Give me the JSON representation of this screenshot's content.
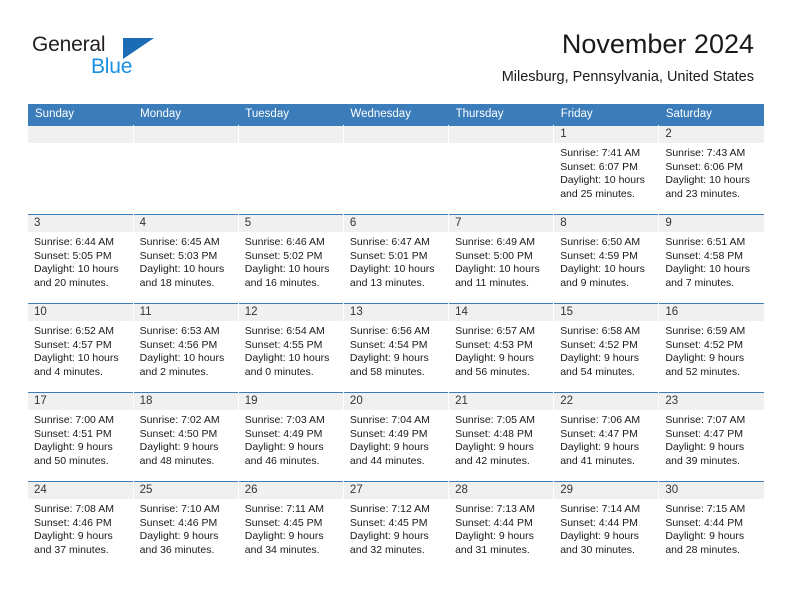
{
  "brand": {
    "name_top": "General",
    "name_bottom": "Blue",
    "triangle_icon": "triangle-icon",
    "color_dark": "#231f20",
    "color_blue": "#1b8ee0",
    "color_triangle": "#1b6bb5"
  },
  "header": {
    "title": "November 2024",
    "subtitle": "Milesburg, Pennsylvania, United States"
  },
  "theme": {
    "header_row_bg": "#3b7cba",
    "header_row_text": "#ffffff",
    "date_band_bg": "#f0f0f0",
    "cell_bg": "#ffffff",
    "row_divider": "#3b7cba"
  },
  "columns": [
    "Sunday",
    "Monday",
    "Tuesday",
    "Wednesday",
    "Thursday",
    "Friday",
    "Saturday"
  ],
  "weeks": [
    [
      {
        "date": "",
        "sunrise": "",
        "sunset": "",
        "daylight_line1": "",
        "daylight_line2": "",
        "empty": true
      },
      {
        "date": "",
        "sunrise": "",
        "sunset": "",
        "daylight_line1": "",
        "daylight_line2": "",
        "empty": true
      },
      {
        "date": "",
        "sunrise": "",
        "sunset": "",
        "daylight_line1": "",
        "daylight_line2": "",
        "empty": true
      },
      {
        "date": "",
        "sunrise": "",
        "sunset": "",
        "daylight_line1": "",
        "daylight_line2": "",
        "empty": true
      },
      {
        "date": "",
        "sunrise": "",
        "sunset": "",
        "daylight_line1": "",
        "daylight_line2": "",
        "empty": true
      },
      {
        "date": "1",
        "sunrise": "Sunrise: 7:41 AM",
        "sunset": "Sunset: 6:07 PM",
        "daylight_line1": "Daylight: 10 hours",
        "daylight_line2": "and 25 minutes.",
        "empty": false
      },
      {
        "date": "2",
        "sunrise": "Sunrise: 7:43 AM",
        "sunset": "Sunset: 6:06 PM",
        "daylight_line1": "Daylight: 10 hours",
        "daylight_line2": "and 23 minutes.",
        "empty": false
      }
    ],
    [
      {
        "date": "3",
        "sunrise": "Sunrise: 6:44 AM",
        "sunset": "Sunset: 5:05 PM",
        "daylight_line1": "Daylight: 10 hours",
        "daylight_line2": "and 20 minutes.",
        "empty": false
      },
      {
        "date": "4",
        "sunrise": "Sunrise: 6:45 AM",
        "sunset": "Sunset: 5:03 PM",
        "daylight_line1": "Daylight: 10 hours",
        "daylight_line2": "and 18 minutes.",
        "empty": false
      },
      {
        "date": "5",
        "sunrise": "Sunrise: 6:46 AM",
        "sunset": "Sunset: 5:02 PM",
        "daylight_line1": "Daylight: 10 hours",
        "daylight_line2": "and 16 minutes.",
        "empty": false
      },
      {
        "date": "6",
        "sunrise": "Sunrise: 6:47 AM",
        "sunset": "Sunset: 5:01 PM",
        "daylight_line1": "Daylight: 10 hours",
        "daylight_line2": "and 13 minutes.",
        "empty": false
      },
      {
        "date": "7",
        "sunrise": "Sunrise: 6:49 AM",
        "sunset": "Sunset: 5:00 PM",
        "daylight_line1": "Daylight: 10 hours",
        "daylight_line2": "and 11 minutes.",
        "empty": false
      },
      {
        "date": "8",
        "sunrise": "Sunrise: 6:50 AM",
        "sunset": "Sunset: 4:59 PM",
        "daylight_line1": "Daylight: 10 hours",
        "daylight_line2": "and 9 minutes.",
        "empty": false
      },
      {
        "date": "9",
        "sunrise": "Sunrise: 6:51 AM",
        "sunset": "Sunset: 4:58 PM",
        "daylight_line1": "Daylight: 10 hours",
        "daylight_line2": "and 7 minutes.",
        "empty": false
      }
    ],
    [
      {
        "date": "10",
        "sunrise": "Sunrise: 6:52 AM",
        "sunset": "Sunset: 4:57 PM",
        "daylight_line1": "Daylight: 10 hours",
        "daylight_line2": "and 4 minutes.",
        "empty": false
      },
      {
        "date": "11",
        "sunrise": "Sunrise: 6:53 AM",
        "sunset": "Sunset: 4:56 PM",
        "daylight_line1": "Daylight: 10 hours",
        "daylight_line2": "and 2 minutes.",
        "empty": false
      },
      {
        "date": "12",
        "sunrise": "Sunrise: 6:54 AM",
        "sunset": "Sunset: 4:55 PM",
        "daylight_line1": "Daylight: 10 hours",
        "daylight_line2": "and 0 minutes.",
        "empty": false
      },
      {
        "date": "13",
        "sunrise": "Sunrise: 6:56 AM",
        "sunset": "Sunset: 4:54 PM",
        "daylight_line1": "Daylight: 9 hours",
        "daylight_line2": "and 58 minutes.",
        "empty": false
      },
      {
        "date": "14",
        "sunrise": "Sunrise: 6:57 AM",
        "sunset": "Sunset: 4:53 PM",
        "daylight_line1": "Daylight: 9 hours",
        "daylight_line2": "and 56 minutes.",
        "empty": false
      },
      {
        "date": "15",
        "sunrise": "Sunrise: 6:58 AM",
        "sunset": "Sunset: 4:52 PM",
        "daylight_line1": "Daylight: 9 hours",
        "daylight_line2": "and 54 minutes.",
        "empty": false
      },
      {
        "date": "16",
        "sunrise": "Sunrise: 6:59 AM",
        "sunset": "Sunset: 4:52 PM",
        "daylight_line1": "Daylight: 9 hours",
        "daylight_line2": "and 52 minutes.",
        "empty": false
      }
    ],
    [
      {
        "date": "17",
        "sunrise": "Sunrise: 7:00 AM",
        "sunset": "Sunset: 4:51 PM",
        "daylight_line1": "Daylight: 9 hours",
        "daylight_line2": "and 50 minutes.",
        "empty": false
      },
      {
        "date": "18",
        "sunrise": "Sunrise: 7:02 AM",
        "sunset": "Sunset: 4:50 PM",
        "daylight_line1": "Daylight: 9 hours",
        "daylight_line2": "and 48 minutes.",
        "empty": false
      },
      {
        "date": "19",
        "sunrise": "Sunrise: 7:03 AM",
        "sunset": "Sunset: 4:49 PM",
        "daylight_line1": "Daylight: 9 hours",
        "daylight_line2": "and 46 minutes.",
        "empty": false
      },
      {
        "date": "20",
        "sunrise": "Sunrise: 7:04 AM",
        "sunset": "Sunset: 4:49 PM",
        "daylight_line1": "Daylight: 9 hours",
        "daylight_line2": "and 44 minutes.",
        "empty": false
      },
      {
        "date": "21",
        "sunrise": "Sunrise: 7:05 AM",
        "sunset": "Sunset: 4:48 PM",
        "daylight_line1": "Daylight: 9 hours",
        "daylight_line2": "and 42 minutes.",
        "empty": false
      },
      {
        "date": "22",
        "sunrise": "Sunrise: 7:06 AM",
        "sunset": "Sunset: 4:47 PM",
        "daylight_line1": "Daylight: 9 hours",
        "daylight_line2": "and 41 minutes.",
        "empty": false
      },
      {
        "date": "23",
        "sunrise": "Sunrise: 7:07 AM",
        "sunset": "Sunset: 4:47 PM",
        "daylight_line1": "Daylight: 9 hours",
        "daylight_line2": "and 39 minutes.",
        "empty": false
      }
    ],
    [
      {
        "date": "24",
        "sunrise": "Sunrise: 7:08 AM",
        "sunset": "Sunset: 4:46 PM",
        "daylight_line1": "Daylight: 9 hours",
        "daylight_line2": "and 37 minutes.",
        "empty": false
      },
      {
        "date": "25",
        "sunrise": "Sunrise: 7:10 AM",
        "sunset": "Sunset: 4:46 PM",
        "daylight_line1": "Daylight: 9 hours",
        "daylight_line2": "and 36 minutes.",
        "empty": false
      },
      {
        "date": "26",
        "sunrise": "Sunrise: 7:11 AM",
        "sunset": "Sunset: 4:45 PM",
        "daylight_line1": "Daylight: 9 hours",
        "daylight_line2": "and 34 minutes.",
        "empty": false
      },
      {
        "date": "27",
        "sunrise": "Sunrise: 7:12 AM",
        "sunset": "Sunset: 4:45 PM",
        "daylight_line1": "Daylight: 9 hours",
        "daylight_line2": "and 32 minutes.",
        "empty": false
      },
      {
        "date": "28",
        "sunrise": "Sunrise: 7:13 AM",
        "sunset": "Sunset: 4:44 PM",
        "daylight_line1": "Daylight: 9 hours",
        "daylight_line2": "and 31 minutes.",
        "empty": false
      },
      {
        "date": "29",
        "sunrise": "Sunrise: 7:14 AM",
        "sunset": "Sunset: 4:44 PM",
        "daylight_line1": "Daylight: 9 hours",
        "daylight_line2": "and 30 minutes.",
        "empty": false
      },
      {
        "date": "30",
        "sunrise": "Sunrise: 7:15 AM",
        "sunset": "Sunset: 4:44 PM",
        "daylight_line1": "Daylight: 9 hours",
        "daylight_line2": "and 28 minutes.",
        "empty": false
      }
    ]
  ]
}
